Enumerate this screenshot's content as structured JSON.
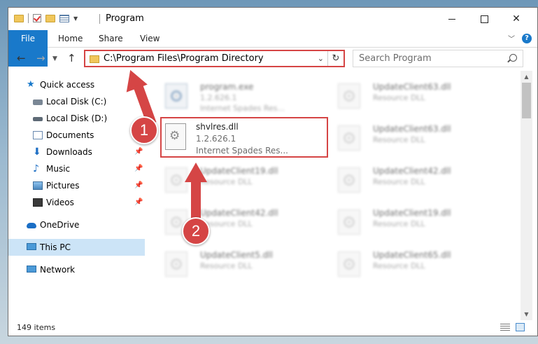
{
  "window": {
    "title": "Program"
  },
  "ribbon": {
    "file": "File",
    "home": "Home",
    "share": "Share",
    "view": "View",
    "help": "?"
  },
  "address": {
    "path": "C:\\Program Files\\Program Directory"
  },
  "search": {
    "placeholder": "Search Program"
  },
  "sidebar": {
    "items": [
      {
        "label": "Quick access"
      },
      {
        "label": "Local Disk (C:)"
      },
      {
        "label": "Local Disk (D:)"
      },
      {
        "label": "Documents"
      },
      {
        "label": "Downloads"
      },
      {
        "label": "Music"
      },
      {
        "label": "Pictures"
      },
      {
        "label": "Videos"
      },
      {
        "label": "OneDrive"
      },
      {
        "label": "This PC"
      },
      {
        "label": "Network"
      }
    ]
  },
  "files": {
    "highlighted": {
      "name": "shvlres.dll",
      "version": "1.2.626.1",
      "description": "Internet Spades Res..."
    },
    "items": [
      {
        "name": "program.exe",
        "line2": "1.2.626.1",
        "line3": "Internet Spades Res..."
      },
      {
        "name": "UpdateClient63.dll",
        "line2": "Resource DLL"
      },
      {
        "name": "UpdateClient63.dll",
        "line2": "Resource DLL"
      },
      {
        "name": "UpdateClient19.dll",
        "line2": "Resource DLL"
      },
      {
        "name": "UpdateClient42.dll",
        "line2": "Resource DLL"
      },
      {
        "name": "UpdateClient42.dll",
        "line2": "Resource DLL"
      },
      {
        "name": "UpdateClient19.dll",
        "line2": "Resource DLL"
      },
      {
        "name": "UpdateClient5.dll",
        "line2": "Resource DLL"
      },
      {
        "name": "UpdateClient65.dll",
        "line2": "Resource DLL"
      }
    ]
  },
  "status": {
    "count": "149 items"
  },
  "annotations": {
    "step1": "1",
    "step2": "2",
    "color": "#d54545"
  }
}
